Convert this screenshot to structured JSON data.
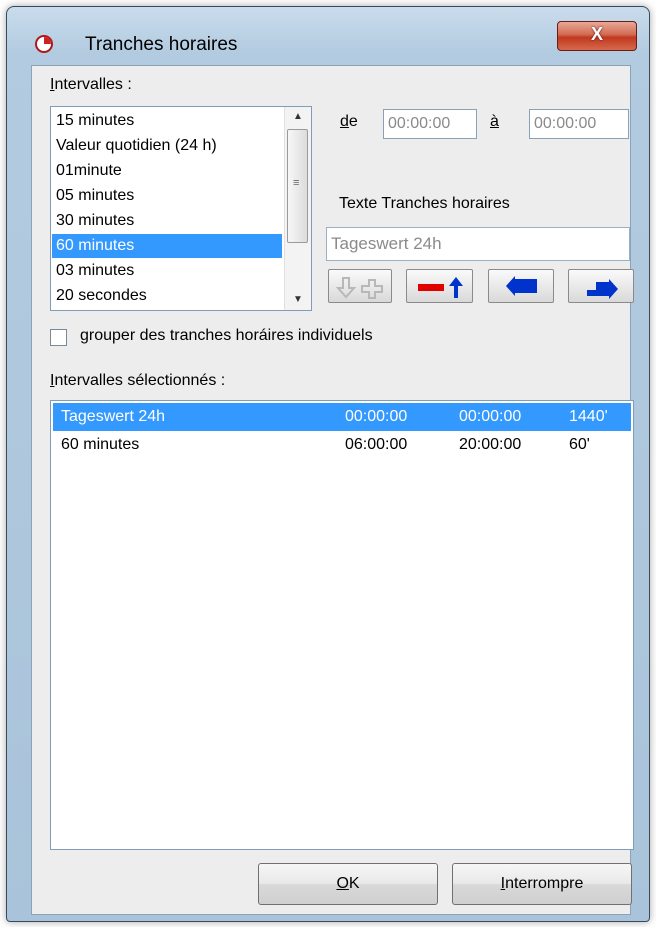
{
  "window": {
    "title": "Tranches horaires",
    "close_label": "X"
  },
  "intervals": {
    "label": "Intervalles :",
    "items": [
      "15 minutes",
      "Valeur quotidien (24 h)",
      "01minute",
      "05 minutes",
      "30 minutes",
      "60 minutes",
      "03 minutes",
      "20 secondes"
    ],
    "selected_index": 5
  },
  "range": {
    "from_label": "de",
    "from_value": "00:00:00",
    "to_label": "à",
    "to_value": "00:00:00"
  },
  "text_section": {
    "label": "Texte Tranches horaires",
    "value": "Tageswert 24h"
  },
  "group_checkbox": {
    "label": "grouper des tranches horáires individuels",
    "checked": false
  },
  "selected_intervals": {
    "label": "Intervalles sélectionnés :",
    "rows": [
      {
        "name": "Tageswert 24h",
        "from": "00:00:00",
        "to": "00:00:00",
        "duration": "1440'"
      },
      {
        "name": "60 minutes",
        "from": "06:00:00",
        "to": "20:00:00",
        "duration": "60'"
      }
    ],
    "selected_index": 0
  },
  "buttons": {
    "ok": "OK",
    "cancel": "Interrompre"
  },
  "icons": {
    "add": "arrow-down-plus-icon",
    "remove": "minus-arrow-up-icon",
    "replace_down": "arrow-down-left-icon",
    "replace_up": "arrow-up-right-icon"
  }
}
